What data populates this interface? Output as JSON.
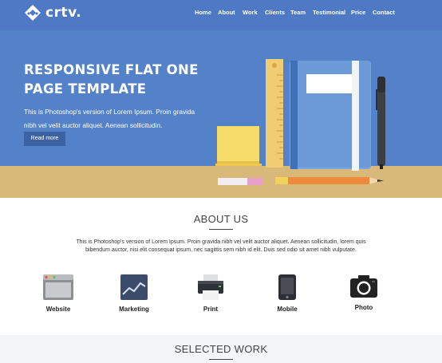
{
  "brand": {
    "name": "crtv."
  },
  "nav": {
    "items": [
      "Home",
      "About",
      "Work",
      "Clients",
      "Team",
      "Testimonial",
      "Price",
      "Contact"
    ]
  },
  "hero": {
    "title": "RESPONSIVE FLAT ONE PAGE TEMPLATE",
    "text": "This is Photoshop's version of Lorem Ipsum. Proin gravida nibh vel velit auctor aliquet. Aenean sollicitudin.",
    "button_label": "Read more"
  },
  "about": {
    "title": "ABOUT US",
    "text": "This is Photoshop's version of Lorem Ipsum. Proin gravida nibh vel velit auctor aliquet. Aenean sollicitudin, lorem quis bibendum auctor, nisi elit consequat ipsum, nec sagittis sem nibh id elit. Duis sed odio sit amet nibh vulputate.",
    "services": [
      {
        "label": "Website",
        "icon": "browser-window-icon"
      },
      {
        "label": "Marketing",
        "icon": "line-chart-icon"
      },
      {
        "label": "Print",
        "icon": "printer-icon"
      },
      {
        "label": "Mobile",
        "icon": "mobile-phone-icon"
      },
      {
        "label": "Photo",
        "icon": "camera-icon"
      }
    ]
  },
  "work": {
    "title": "SELECTED WORK"
  },
  "colors": {
    "header": "#4f79c4",
    "hero": "#5382c9",
    "floor": "#d8b97a",
    "button": "#3b63a4"
  }
}
